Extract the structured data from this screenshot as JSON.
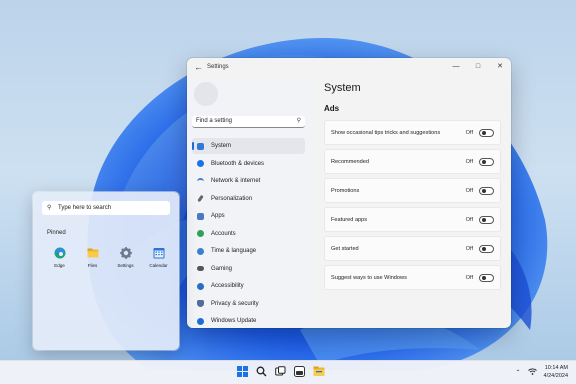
{
  "settings": {
    "window_title": "Settings",
    "search_placeholder": "Find a setting",
    "nav": [
      {
        "label": "System",
        "icon": "monitor-icon",
        "color": "#2f7ad8"
      },
      {
        "label": "Bluetooth & devices",
        "icon": "bluetooth-icon",
        "color": "#1a73e8"
      },
      {
        "label": "Network & internet",
        "icon": "wifi-icon",
        "color": "#3b7ecf"
      },
      {
        "label": "Personalization",
        "icon": "brush-icon",
        "color": "#666666"
      },
      {
        "label": "Apps",
        "icon": "apps-icon",
        "color": "#4a79c2"
      },
      {
        "label": "Accounts",
        "icon": "person-icon",
        "color": "#2da05a"
      },
      {
        "label": "Time & language",
        "icon": "globe-icon",
        "color": "#3a80d2"
      },
      {
        "label": "Gaming",
        "icon": "controller-icon",
        "color": "#555555"
      },
      {
        "label": "Accessibility",
        "icon": "accessibility-icon",
        "color": "#2a6dc4"
      },
      {
        "label": "Privacy & security",
        "icon": "shield-icon",
        "color": "#4f6f99"
      },
      {
        "label": "Windows Update",
        "icon": "update-icon",
        "color": "#1b6ed8"
      }
    ],
    "page_heading": "System",
    "section_title": "Ads",
    "rows": [
      {
        "label": "Show occasional tips  tricks  and suggestions",
        "state": "Off"
      },
      {
        "label": "Recommended",
        "state": "Off"
      },
      {
        "label": "Promotions",
        "state": "Off"
      },
      {
        "label": "Featured apps",
        "state": "Off"
      },
      {
        "label": "Get started",
        "state": "Off"
      },
      {
        "label": "Suggest ways to use Windows",
        "state": "Off"
      }
    ]
  },
  "start": {
    "search_placeholder": "Type here to search",
    "pinned_label": "Pinned",
    "apps": [
      {
        "name": "Edge",
        "icon": "edge-icon"
      },
      {
        "name": "Files",
        "icon": "folder-icon"
      },
      {
        "name": "Settings",
        "icon": "gear-icon"
      },
      {
        "name": "Calendar",
        "icon": "calendar-icon"
      }
    ]
  },
  "taskbar": {
    "icons": [
      "windows-logo-icon",
      "search-icon",
      "task-view-icon",
      "widgets-icon",
      "file-explorer-icon"
    ],
    "time": "10:14 AM",
    "date": "4/24/2024"
  },
  "colors": {
    "accent": "#1a6cd8",
    "wallpaper": "#1f5fe0"
  }
}
